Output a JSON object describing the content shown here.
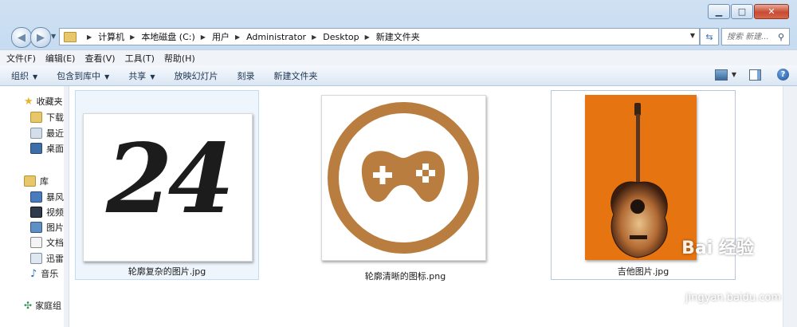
{
  "address": {
    "crumbs": [
      "计算机",
      "本地磁盘 (C:)",
      "用户",
      "Administrator",
      "Desktop",
      "新建文件夹"
    ]
  },
  "search": {
    "placeholder": "搜索 新建..."
  },
  "menu": [
    "文件(F)",
    "编辑(E)",
    "查看(V)",
    "工具(T)",
    "帮助(H)"
  ],
  "toolbar": {
    "organize": "组织",
    "include_library": "包含到库中",
    "share": "共享",
    "slideshow": "放映幻灯片",
    "burn": "刻录",
    "new_folder": "新建文件夹"
  },
  "nav": {
    "favorites": "收藏夹",
    "downloads": "下载",
    "recent": "最近",
    "desktop": "桌面",
    "libraries": "库",
    "storm": "暴风",
    "videos": "视频",
    "pictures": "图片",
    "documents": "文档",
    "thunder": "迅雷",
    "music": "音乐",
    "homegroup": "家庭组"
  },
  "files": [
    {
      "name": "轮廓复杂的图片.jpg",
      "content": "24"
    },
    {
      "name": "轮廓清晰的图标.png"
    },
    {
      "name": "吉他图片.jpg"
    }
  ],
  "watermark": {
    "logo": "Bai 经验",
    "url": "jingyan.baidu.com"
  },
  "colors": {
    "icon_brown": "#b97d3f",
    "orange_bg": "#e57411",
    "selection": "#eef5fd"
  }
}
